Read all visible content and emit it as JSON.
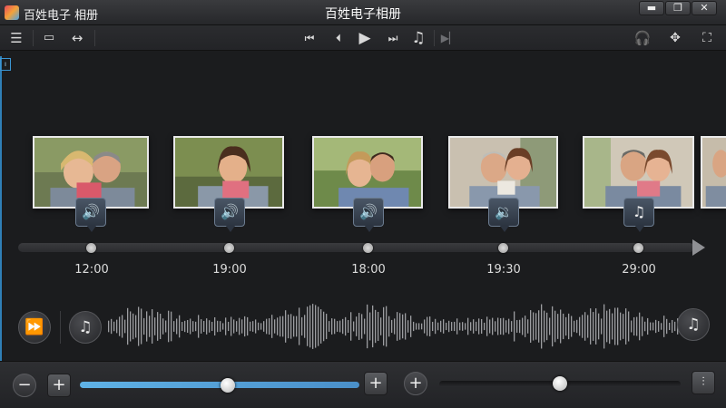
{
  "window": {
    "app_name": "百姓电子 相册",
    "title": "百姓电子相册",
    "minimize_glyph": "▬",
    "maximize_glyph": "❐",
    "close_glyph": "✕"
  },
  "toolbar": {
    "left_icons": [
      "menu-icon",
      "screen-icon",
      "swap-arrows-icon"
    ],
    "center_icons": [
      "skip-start-icon",
      "previous-icon",
      "play-icon",
      "next-icon",
      "music-note-icon",
      "play-to-end-icon"
    ],
    "right_icons": [
      "headphones-icon",
      "move-arrows-icon",
      "crop-icon"
    ]
  },
  "left_marker": "ı",
  "photos": [
    {
      "name": "photo-1",
      "badge_icon": "speaker-icon",
      "badge_glyph": "🔊"
    },
    {
      "name": "photo-2",
      "badge_icon": "speaker-wave-icon",
      "badge_glyph": "🔊"
    },
    {
      "name": "photo-3",
      "badge_icon": "speaker-icon",
      "badge_glyph": "🔊"
    },
    {
      "name": "photo-4",
      "badge_icon": "speaker-muted-icon",
      "badge_glyph": "🔉"
    },
    {
      "name": "photo-5",
      "badge_icon": "music-note-icon",
      "badge_glyph": "♫"
    },
    {
      "name": "photo-6"
    }
  ],
  "timeline": {
    "times": [
      "12:00",
      "19:00",
      "18:00",
      "19:30",
      "29:00"
    ]
  },
  "waveform_row": {
    "left_button_icon": "fast-forward-icon",
    "left_music_icon": "music-note-icon",
    "right_music_icon": "music-note-icon"
  },
  "bottom": {
    "minus_label": "−",
    "plus_label": "+",
    "plus_right_label": "+",
    "plus_circle_label": "+",
    "end_button_icon": "waveform-icon",
    "zoom_slider_value": 0.53,
    "position_slider_value": 0.5
  },
  "colors": {
    "accent": "#4a9fd8",
    "background": "#1b1c1e"
  }
}
